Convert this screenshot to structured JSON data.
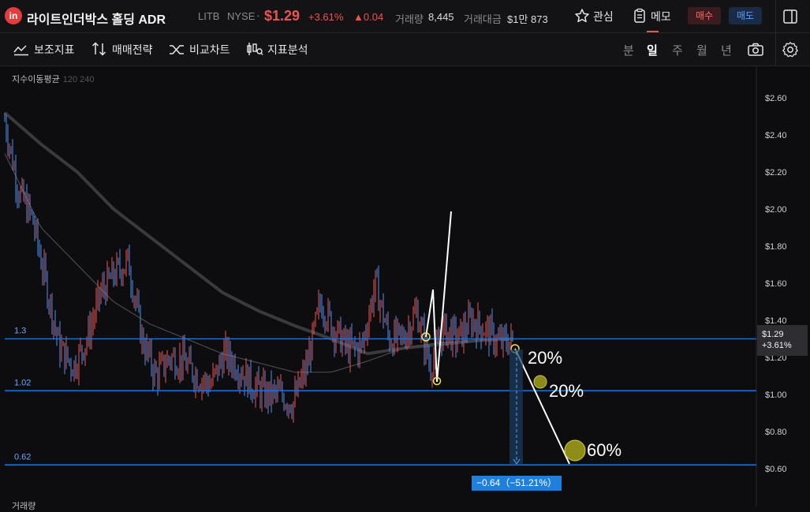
{
  "header": {
    "logo_text": "in",
    "name": "라이트인더박스 홀딩 ADR",
    "ticker": "LITB",
    "exchange": "NYSE",
    "separator": "·",
    "price": "$1.29",
    "change_pct": "+3.61%",
    "change_abs": "▲0.04",
    "volume_label": "거래량",
    "volume_value": "8,445",
    "amount_label": "거래대금",
    "amount_value": "$1만 873",
    "watch_label": "관심",
    "memo_label": "메모",
    "buy_label": "매수",
    "sell_label": "매도"
  },
  "toolbar": {
    "indicators": "보조지표",
    "strategy": "매매전략",
    "compare": "비교차트",
    "analysis": "지표분석",
    "periods": [
      "분",
      "일",
      "주",
      "월",
      "년"
    ],
    "active_period": "일"
  },
  "chart": {
    "ma_label": "지수이동평균",
    "ma_params": "120 240",
    "y_ticks": [
      "$2.60",
      "$2.40",
      "$2.20",
      "$2.00",
      "$1.80",
      "$1.60",
      "$1.40",
      "$1.20",
      "$1.00",
      "$0.80",
      "$0.60"
    ],
    "lines": [
      {
        "label": "1.3",
        "value": 1.3
      },
      {
        "label": "1.02",
        "value": 1.02
      },
      {
        "label": "0.62",
        "value": 0.62
      }
    ],
    "current_price": "$1.29",
    "current_change": "+3.61%",
    "measure_label": "−0.64（−51.21%）",
    "annotations": [
      "20%",
      "20%",
      "60%"
    ],
    "volume_label": "거래량"
  },
  "colors": {
    "up": "#f0524f",
    "down": "#4f8ff0",
    "hline": "#1e6fe0",
    "accent": "#f0524f"
  },
  "chart_data": {
    "type": "candlestick",
    "ylim": [
      0.56,
      2.75
    ],
    "y_ticks": [
      2.6,
      2.4,
      2.2,
      2.0,
      1.8,
      1.6,
      1.4,
      1.2,
      1.0,
      0.8,
      0.6
    ],
    "price_path": [
      2.48,
      2.1,
      1.95,
      1.6,
      1.25,
      1.15,
      1.3,
      1.55,
      1.65,
      1.72,
      1.3,
      1.1,
      1.2,
      1.18,
      1.1,
      1.05,
      1.22,
      1.15,
      1.05,
      1.0,
      1.0,
      0.95,
      1.15,
      1.5,
      1.35,
      1.25,
      1.25,
      1.6,
      1.3,
      1.3,
      1.45,
      1.15,
      1.35,
      1.3,
      1.4,
      1.35,
      1.28,
      1.29
    ],
    "ema_120": [
      2.3,
      1.9,
      1.7,
      1.5,
      1.38,
      1.3,
      1.22,
      1.17,
      1.12,
      1.12,
      1.18,
      1.25,
      1.28,
      1.29,
      1.3
    ],
    "ema_240": [
      2.52,
      2.35,
      2.2,
      2.0,
      1.85,
      1.7,
      1.55,
      1.45,
      1.37,
      1.3,
      1.22,
      1.25,
      1.27,
      1.29,
      1.3
    ]
  }
}
